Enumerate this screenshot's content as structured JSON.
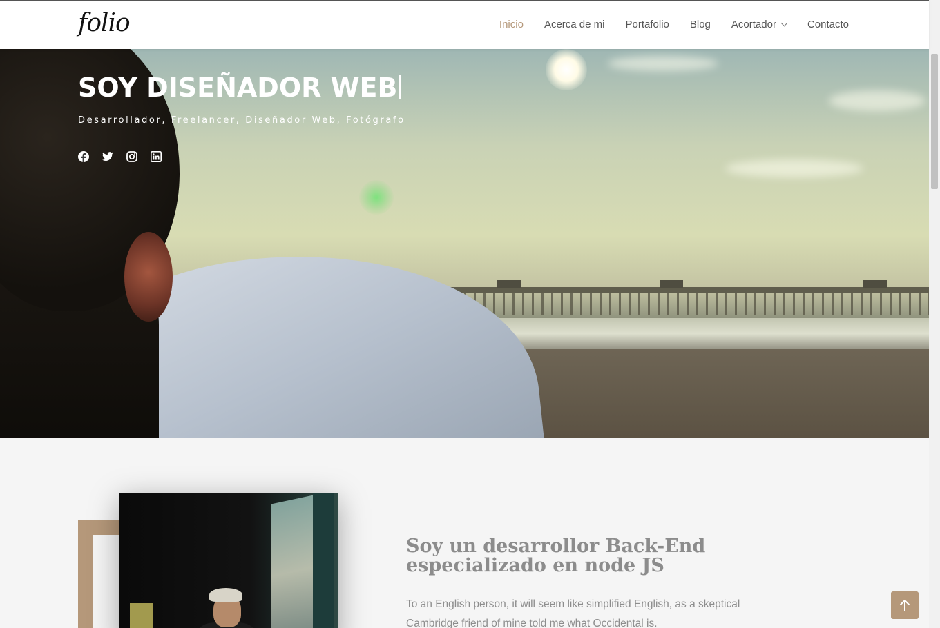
{
  "navbar": {
    "logo": "folio",
    "items": [
      {
        "label": "Inicio",
        "active": true
      },
      {
        "label": "Acerca de mi",
        "active": false
      },
      {
        "label": "Portafolio",
        "active": false
      },
      {
        "label": "Blog",
        "active": false
      },
      {
        "label": "Acortador",
        "active": false,
        "dropdown": true
      },
      {
        "label": "Contacto",
        "active": false
      }
    ]
  },
  "hero": {
    "title": "SOY DISEÑADOR WEB",
    "subtitle": "Desarrollador, Freelancer, Diseñador Web, Fotógrafo",
    "socials": [
      "facebook-icon",
      "twitter-icon",
      "instagram-icon",
      "linkedin-icon"
    ]
  },
  "about": {
    "title": "Soy un desarrollor Back-End especializado en node JS",
    "text": "To an English person, it will seem like simplified English, as a skeptical Cambridge friend of mine told me what Occidental is."
  },
  "colors": {
    "accent": "#b5987a",
    "nav_text": "#555555",
    "muted_text": "#8c8c8c"
  },
  "icons": {
    "back_to_top": "arrow-up-icon"
  }
}
